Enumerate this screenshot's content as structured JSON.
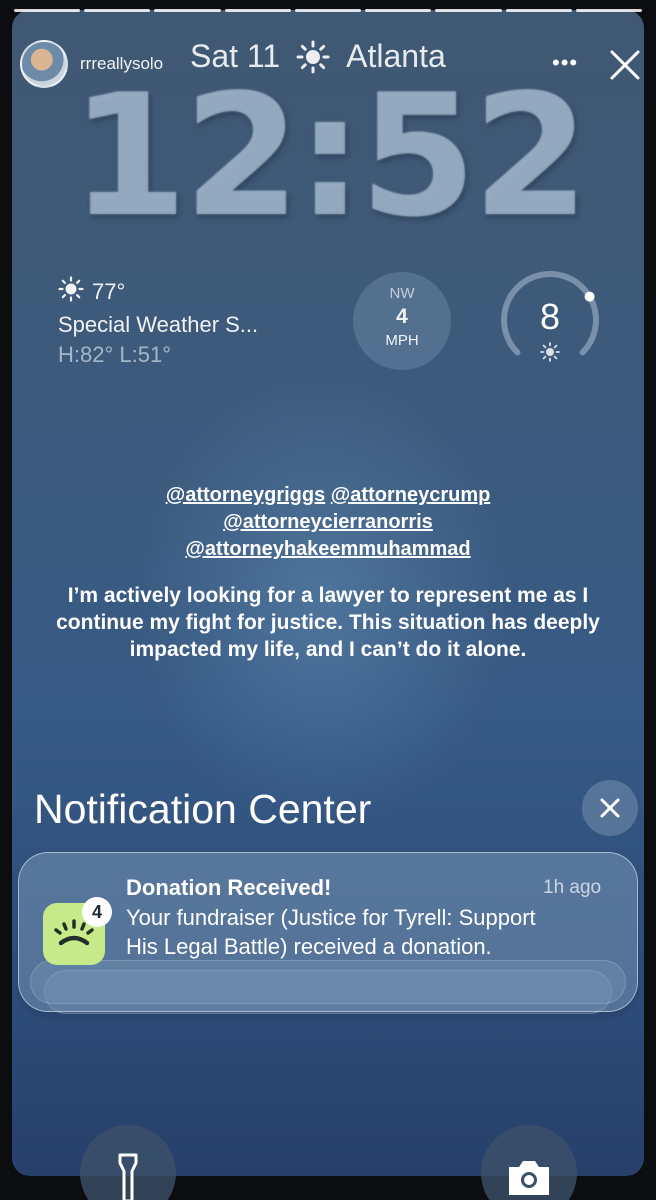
{
  "story": {
    "segments": 9,
    "username": "rrreallysolo",
    "more_label": "•••"
  },
  "lockscreen": {
    "date": "Sat 11",
    "city": "Atlanta",
    "time": "12:52",
    "weather": {
      "temp": "77°",
      "condition": "Special Weather S...",
      "high_low": "H:82° L:51°"
    },
    "wind": {
      "direction": "NW",
      "speed": "4",
      "unit": "MPH"
    },
    "uv": {
      "value": "8",
      "fraction": 0.72
    }
  },
  "caption": {
    "mentions": [
      "@attorneygriggs",
      "@attorneycrump",
      "@attorneycierranorris",
      "@attorneyhakeemmuhammad"
    ],
    "message": "I’m actively looking for a lawyer to represent me as I continue my fight for justice. This situation has deeply impacted my life, and I can’t do it alone."
  },
  "notification_center": {
    "title": "Notification Center",
    "notification": {
      "title": "Donation Received!",
      "time": "1h ago",
      "body": "Your fundraiser (Justice for Tyrell: Support His Legal Battle) received a donation.",
      "badge": "4",
      "app_icon_color": "#c6ea8a"
    }
  },
  "colors": {
    "background_top": "#3f5873",
    "background_bottom": "#26406a"
  }
}
